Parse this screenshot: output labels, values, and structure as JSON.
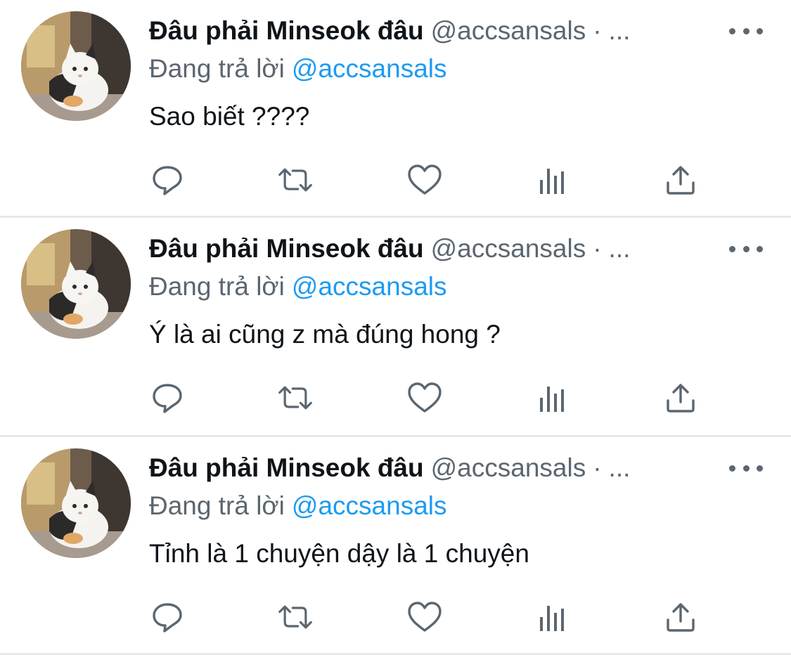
{
  "colors": {
    "text": "#0f1419",
    "muted": "#5b6670",
    "link": "#1d9bf0",
    "divider": "#e6e9ec"
  },
  "tweets": [
    {
      "author_name": "Đâu phải Minseok đâu",
      "author_handle": "@accsansals",
      "separator": "·",
      "truncated": "...",
      "reply_prefix": "Đang trả lời",
      "reply_to": "@accsansals",
      "text": "Sao biết ????",
      "icons": [
        "reply-icon",
        "retweet-icon",
        "like-icon",
        "analytics-icon",
        "share-icon"
      ]
    },
    {
      "author_name": "Đâu phải Minseok đâu",
      "author_handle": "@accsansals",
      "separator": "·",
      "truncated": "...",
      "reply_prefix": "Đang trả lời",
      "reply_to": "@accsansals",
      "text": "Ý là ai cũng z mà đúng hong ?",
      "icons": [
        "reply-icon",
        "retweet-icon",
        "like-icon",
        "analytics-icon",
        "share-icon"
      ]
    },
    {
      "author_name": "Đâu phải Minseok đâu",
      "author_handle": "@accsansals",
      "separator": "·",
      "truncated": "...",
      "reply_prefix": "Đang trả lời",
      "reply_to": "@accsansals",
      "text": "Tỉnh là 1 chuyện dậy là 1 chuyện",
      "icons": [
        "reply-icon",
        "retweet-icon",
        "like-icon",
        "analytics-icon",
        "share-icon"
      ]
    }
  ]
}
